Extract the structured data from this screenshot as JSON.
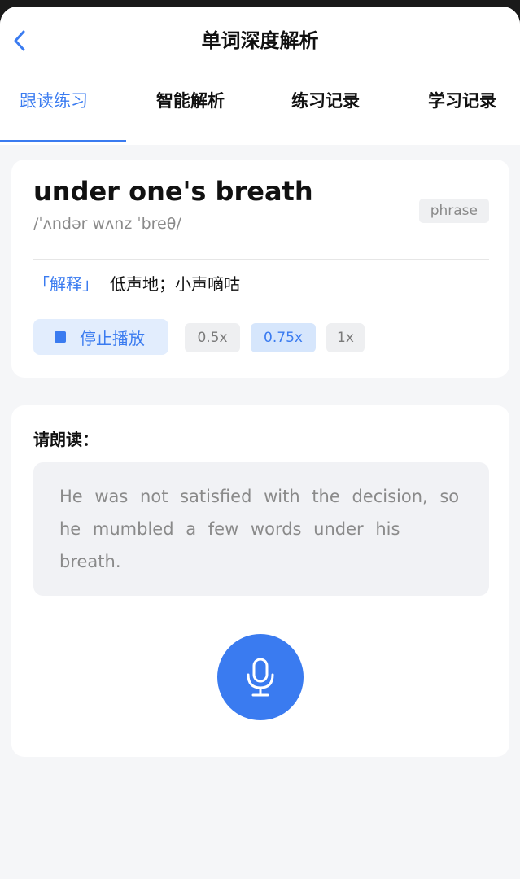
{
  "header": {
    "title": "单词深度解析",
    "back_icon": "chevron-left-icon"
  },
  "tabs": [
    {
      "label": "跟读练习",
      "active": true
    },
    {
      "label": "智能解析",
      "active": false
    },
    {
      "label": "练习记录",
      "active": false
    },
    {
      "label": "学习记录",
      "active": false
    }
  ],
  "word_card": {
    "word": "under one's breath",
    "phonetic": "/ˈʌndər wʌnz ˈbreθ/",
    "part_of_speech": "phrase",
    "definition_label": "「解释」",
    "definition": "低声地；小声嘀咕",
    "stop_label": "停止播放",
    "stop_icon": "stop-icon",
    "speeds": [
      {
        "label": "0.5x",
        "selected": false
      },
      {
        "label": "0.75x",
        "selected": true
      },
      {
        "label": "1x",
        "selected": false
      }
    ]
  },
  "reading": {
    "prompt": "请朗读：",
    "sentence": "He was not satisfied with the decision, so he mumbled a few words under his breath.",
    "mic_icon": "microphone-icon"
  },
  "colors": {
    "accent": "#3a7bf0",
    "accent_light": "#e2edfd",
    "background": "#f5f6f8"
  }
}
